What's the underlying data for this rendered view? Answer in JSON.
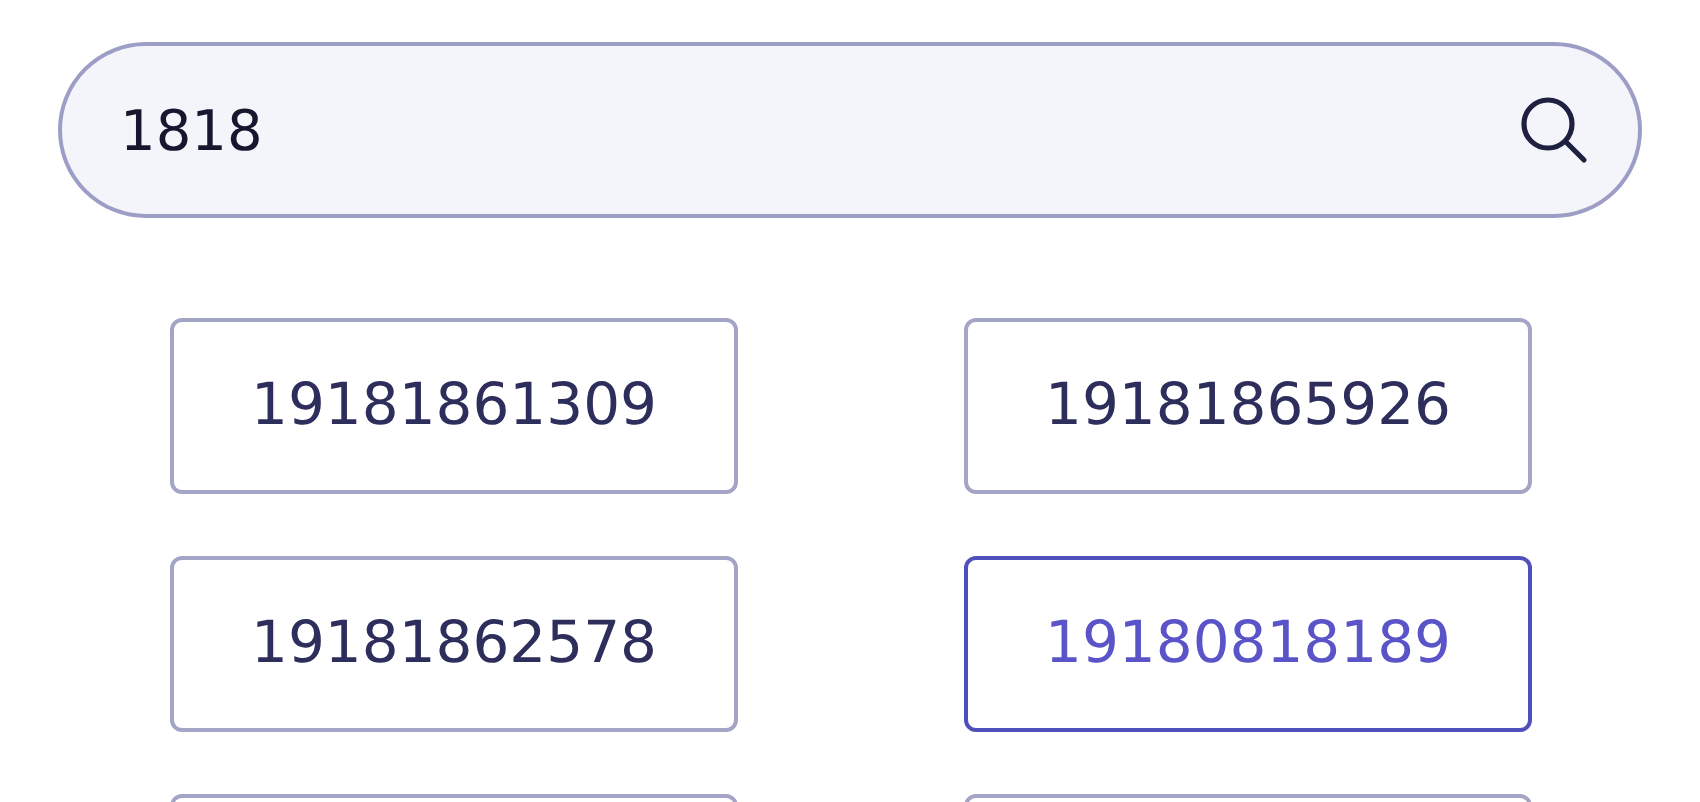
{
  "search": {
    "value": "1818"
  },
  "options": [
    {
      "label": "19181861309",
      "selected": false
    },
    {
      "label": "19181865926",
      "selected": false
    },
    {
      "label": "19181862578",
      "selected": false
    },
    {
      "label": "19180818189",
      "selected": true
    },
    {
      "selected": false
    },
    {
      "selected": false
    }
  ]
}
